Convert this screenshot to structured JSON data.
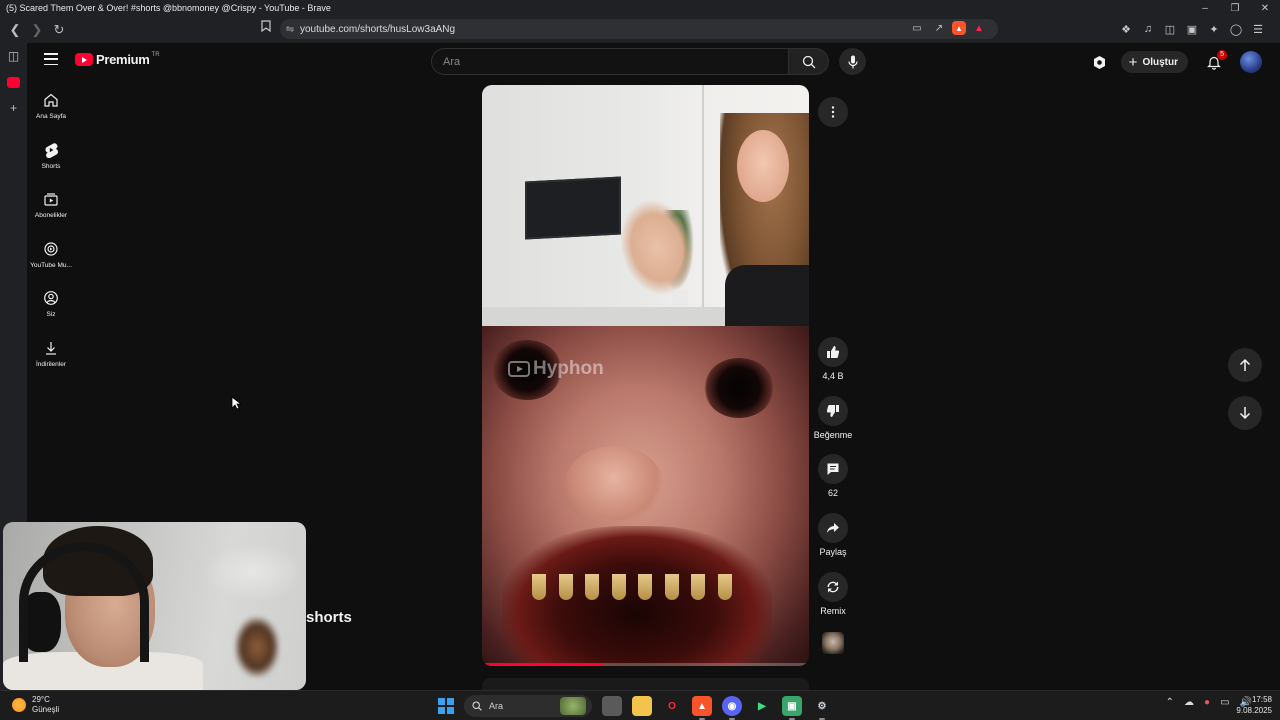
{
  "browser": {
    "window_title": "(5) Scared Them Over & Over! #shorts @bbnomoney @Crispy - YouTube - Brave",
    "url": "youtube.com/shorts/husLow3aANg"
  },
  "youtube": {
    "logo_text": "Premium",
    "country_code": "TR",
    "search_placeholder": "Ara",
    "create_label": "Oluştur",
    "notification_count": "5",
    "nav": [
      {
        "label": "Ana Sayfa",
        "icon": "home-icon"
      },
      {
        "label": "Shorts",
        "icon": "shorts-icon"
      },
      {
        "label": "Abonelikler",
        "icon": "subscriptions-icon"
      },
      {
        "label": "YouTube Mu...",
        "icon": "youtube-music-icon"
      },
      {
        "label": "Siz",
        "icon": "you-icon"
      },
      {
        "label": "İndirilenler",
        "icon": "download-icon"
      }
    ]
  },
  "short": {
    "watermark": "Hyphon",
    "progress_fraction": 0.37,
    "actions": {
      "like_count": "4,4 B",
      "dislike_label": "Beğenme",
      "comment_count": "62",
      "share_label": "Paylaş",
      "remix_label": "Remix"
    }
  },
  "overlay": {
    "shorts_text": "shorts"
  },
  "taskbar": {
    "temperature": "29°C",
    "weather": "Güneşli",
    "search_placeholder": "Ara",
    "time": "17:58",
    "date": "9.08.2025"
  },
  "colors": {
    "youtube_red": "#ff0033",
    "background": "#0f0f0f",
    "chip": "#272727"
  }
}
